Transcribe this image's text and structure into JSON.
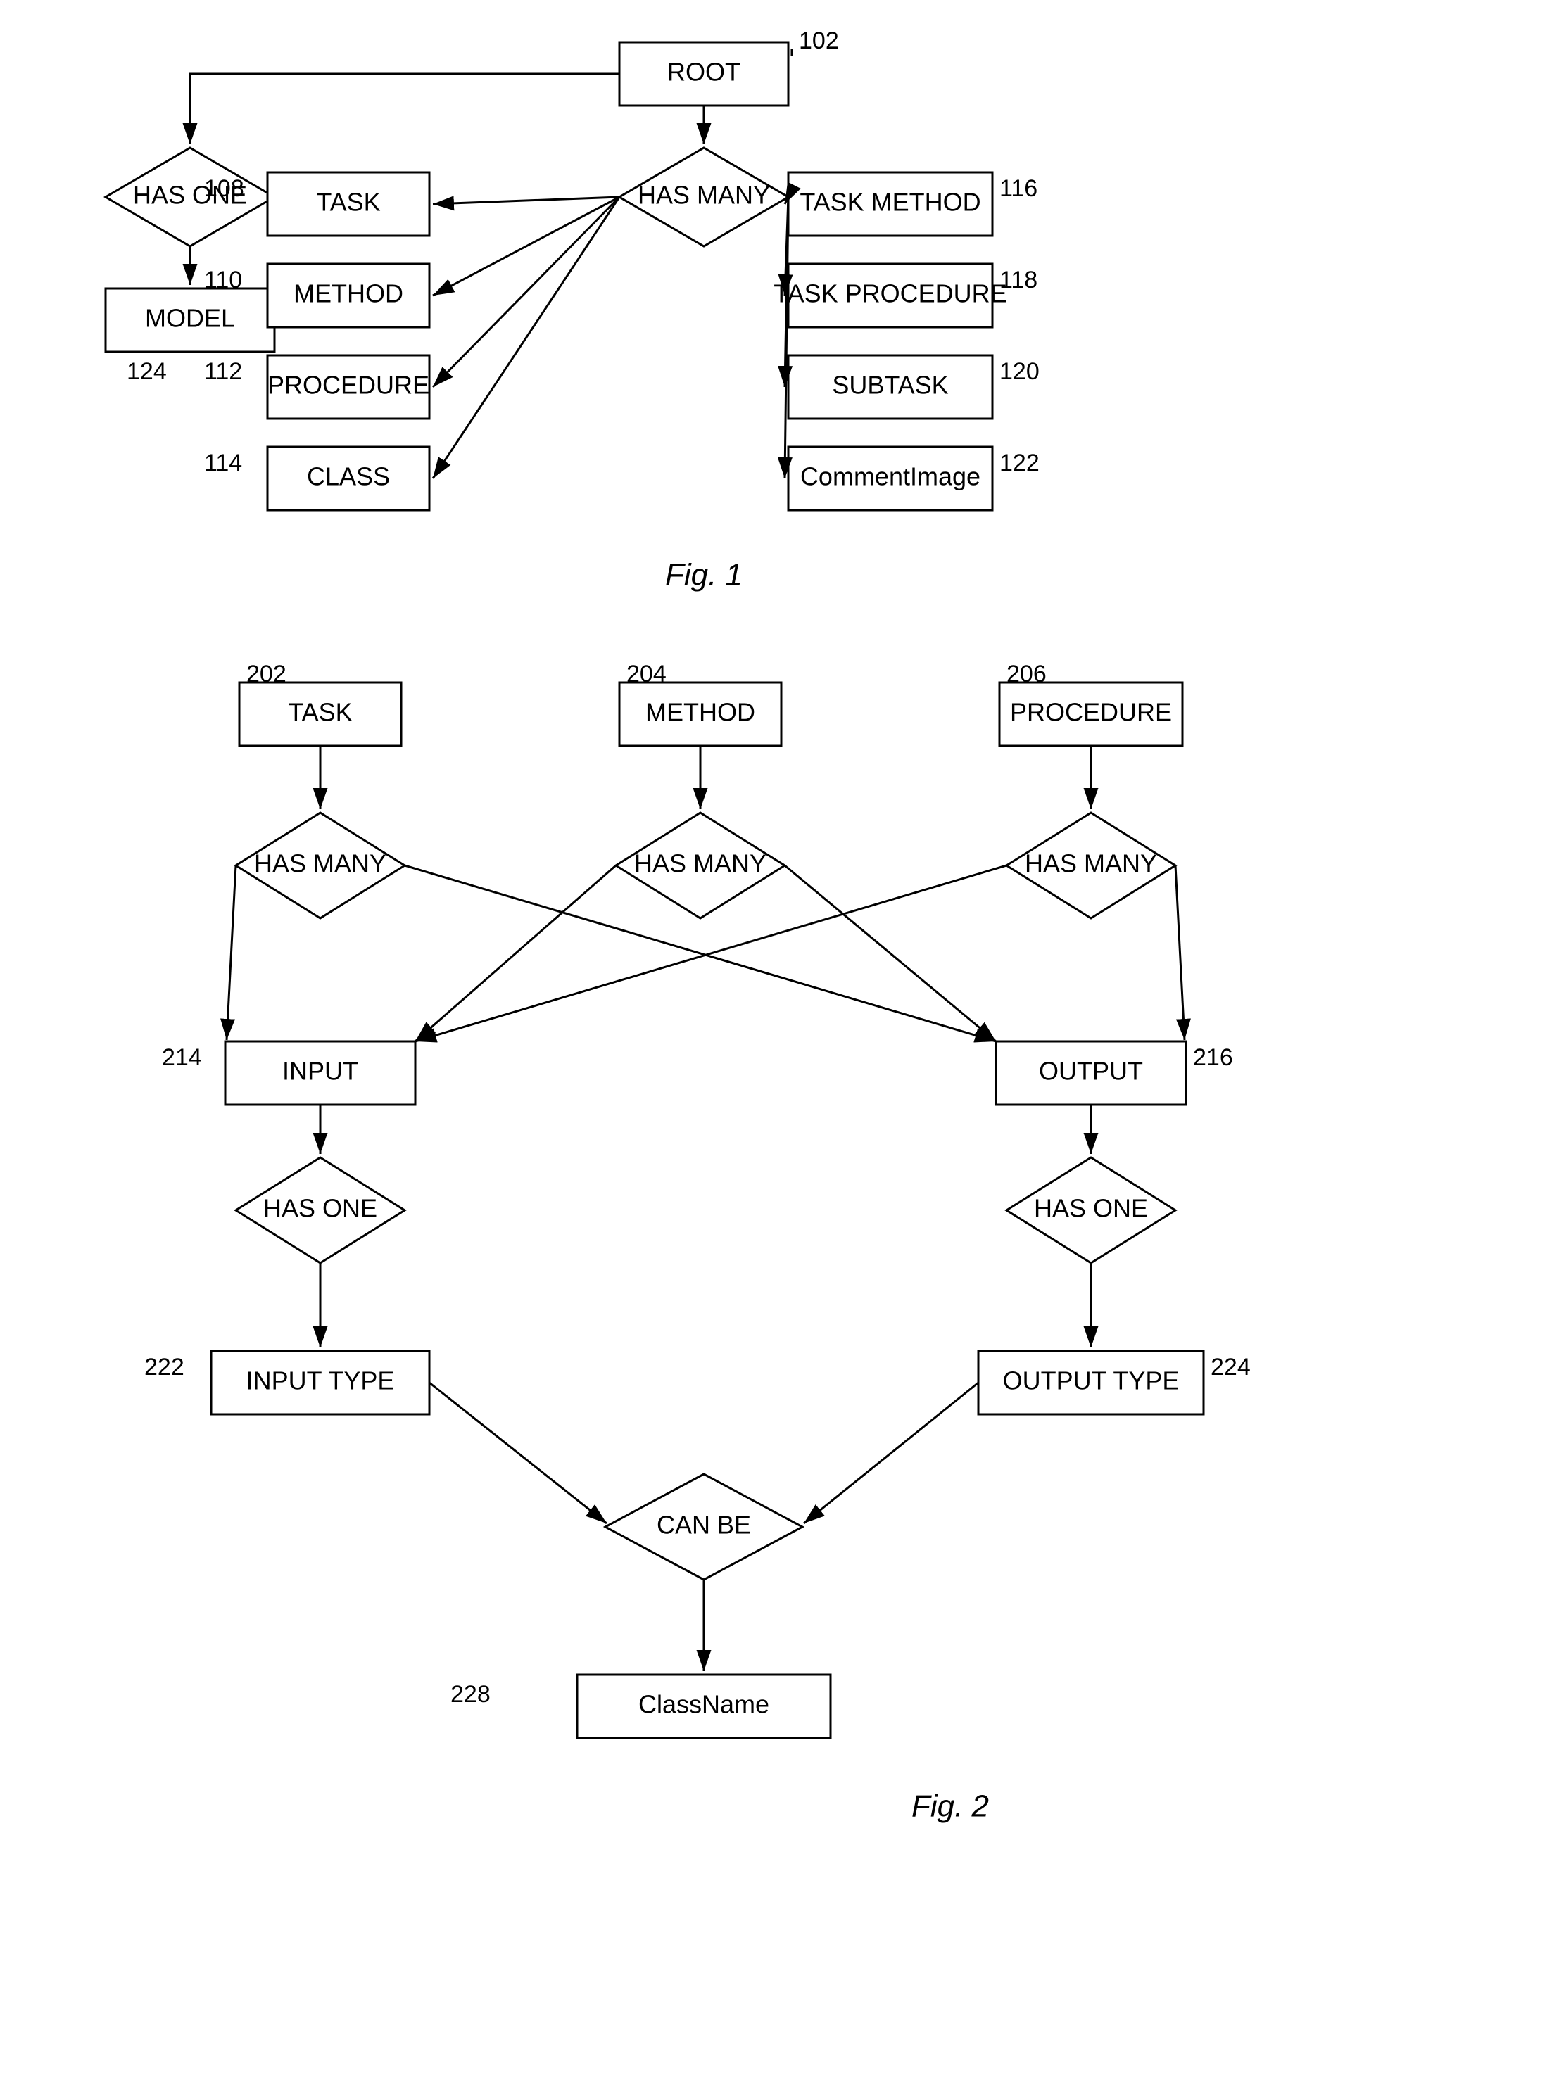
{
  "fig1": {
    "title": "Fig. 1",
    "nodes": {
      "root": {
        "label": "ROOT",
        "ref": "102"
      },
      "has_many_top": {
        "label": "HAS MANY"
      },
      "has_one": {
        "label": "HAS ONE"
      },
      "model": {
        "label": "MODEL",
        "ref": "124"
      },
      "task": {
        "label": "TASK",
        "ref": "108"
      },
      "method": {
        "label": "METHOD",
        "ref": "110"
      },
      "procedure": {
        "label": "PROCEDURE",
        "ref": "112"
      },
      "class": {
        "label": "CLASS",
        "ref": "114"
      },
      "task_method": {
        "label": "TASK METHOD",
        "ref": "116"
      },
      "task_procedure": {
        "label": "TASK PROCEDURE",
        "ref": "118"
      },
      "subtask": {
        "label": "SUBTASK",
        "ref": "120"
      },
      "comment_image": {
        "label": "CommentImage",
        "ref": "122"
      }
    }
  },
  "fig2": {
    "title": "Fig. 2",
    "nodes": {
      "task": {
        "label": "TASK",
        "ref": "202"
      },
      "method": {
        "label": "METHOD",
        "ref": "204"
      },
      "procedure": {
        "label": "PROCEDURE",
        "ref": "206"
      },
      "has_many_task": {
        "label": "HAS MANY"
      },
      "has_many_method": {
        "label": "HAS MANY"
      },
      "has_many_proc": {
        "label": "HAS MANY"
      },
      "input": {
        "label": "INPUT",
        "ref": "214"
      },
      "output": {
        "label": "OUTPUT",
        "ref": "216"
      },
      "has_one_input": {
        "label": "HAS ONE"
      },
      "has_one_output": {
        "label": "HAS ONE"
      },
      "input_type": {
        "label": "INPUT TYPE",
        "ref": "222"
      },
      "output_type": {
        "label": "OUTPUT TYPE",
        "ref": "224"
      },
      "can_be": {
        "label": "CAN BE"
      },
      "class_name": {
        "label": "ClassName",
        "ref": "228"
      }
    }
  }
}
